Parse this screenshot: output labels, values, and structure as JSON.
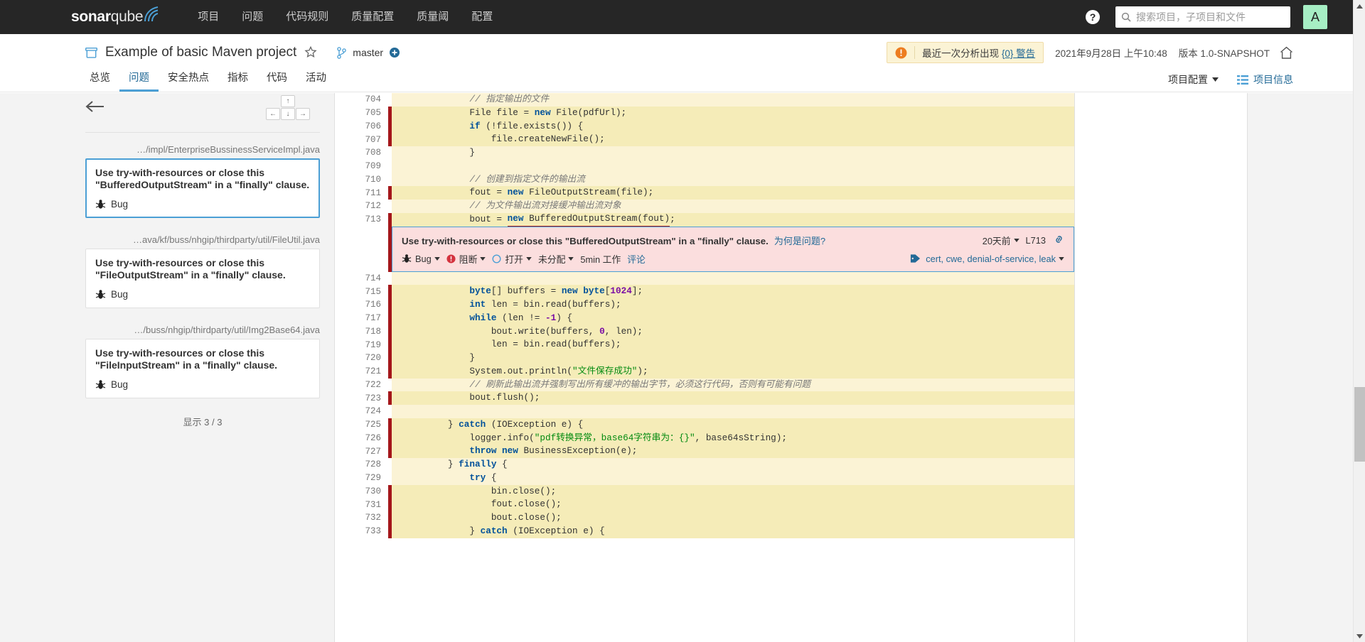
{
  "topnav": {
    "logo_bold": "sonar",
    "logo_light": "qube",
    "links": [
      {
        "label": "项目",
        "active": false
      },
      {
        "label": "问题",
        "active": false
      },
      {
        "label": "代码规则",
        "active": false
      },
      {
        "label": "质量配置",
        "active": false
      },
      {
        "label": "质量阈",
        "active": false
      },
      {
        "label": "配置",
        "active": false
      }
    ],
    "help_label": "?",
    "search_placeholder": "搜索项目，子项目和文件",
    "search_value": "",
    "avatar_letter": "A",
    "avatar_color": "#a6eec4"
  },
  "project_header": {
    "title": "Example of basic Maven project",
    "branch": "master",
    "warning_prefix": "最近一次分析出现 ",
    "warning_link": "{0} 警告",
    "analysis_date": "2021年9月28日 上午10:48",
    "version": "版本 1.0-SNAPSHOT"
  },
  "tabs": [
    {
      "label": "总览",
      "active": false
    },
    {
      "label": "问题",
      "active": true
    },
    {
      "label": "安全热点",
      "active": false
    },
    {
      "label": "指标",
      "active": false
    },
    {
      "label": "代码",
      "active": false
    },
    {
      "label": "活动",
      "active": false
    }
  ],
  "tabs_right": {
    "project_config": "项目配置",
    "project_info": "项目信息"
  },
  "sidebar": {
    "items": [
      {
        "path": "…/impl/EnterpriseBussinessServiceImpl.java",
        "message": "Use try-with-resources or close this \"BufferedOutputStream\" in a \"finally\" clause.",
        "type": "Bug",
        "selected": true
      },
      {
        "path": "…ava/kf/buss/nhgip/thirdparty/util/FileUtil.java",
        "message": "Use try-with-resources or close this \"FileOutputStream\" in a \"finally\" clause.",
        "type": "Bug",
        "selected": false
      },
      {
        "path": "…/buss/nhgip/thirdparty/util/Img2Base64.java",
        "message": "Use try-with-resources or close this \"FileInputStream\" in a \"finally\" clause.",
        "type": "Bug",
        "selected": false
      }
    ],
    "count_label": "显示 3 / 3"
  },
  "issue_detail": {
    "message": "Use try-with-resources or close this \"BufferedOutputStream\" in a \"finally\" clause.",
    "why_link": "为何是问题?",
    "date": "20天前",
    "line_label": "L713",
    "type": "Bug",
    "severity": "阻断",
    "status": "打开",
    "assignee": "未分配",
    "effort": "5min 工作",
    "comment": "评论",
    "tags": "cert, cwe, denial-of-service, leak"
  },
  "code": {
    "lines": [
      {
        "n": "704",
        "hl": "hl2",
        "bar": false,
        "clipped": true,
        "tokens": [
          {
            "t": "            // 指定输出的文件",
            "c": "cmt"
          }
        ]
      },
      {
        "n": "705",
        "hl": "hl",
        "bar": true,
        "tokens": [
          {
            "t": "            File file = ",
            "c": ""
          },
          {
            "t": "new",
            "c": "kw"
          },
          {
            "t": " File(pdfUrl);",
            "c": ""
          }
        ]
      },
      {
        "n": "706",
        "hl": "hl",
        "bar": true,
        "tokens": [
          {
            "t": "            ",
            "c": ""
          },
          {
            "t": "if",
            "c": "kw"
          },
          {
            "t": " (!file.exists()) {",
            "c": ""
          }
        ]
      },
      {
        "n": "707",
        "hl": "hl",
        "bar": true,
        "tokens": [
          {
            "t": "                file.createNewFile();",
            "c": ""
          }
        ]
      },
      {
        "n": "708",
        "hl": "hl2",
        "bar": false,
        "tokens": [
          {
            "t": "            }",
            "c": ""
          }
        ]
      },
      {
        "n": "709",
        "hl": "hl2",
        "bar": false,
        "tokens": []
      },
      {
        "n": "710",
        "hl": "hl2",
        "bar": false,
        "tokens": [
          {
            "t": "            // 创建到指定文件的输出流",
            "c": "cmt"
          }
        ]
      },
      {
        "n": "711",
        "hl": "hl",
        "bar": true,
        "tokens": [
          {
            "t": "            fout = ",
            "c": ""
          },
          {
            "t": "new",
            "c": "kw"
          },
          {
            "t": " FileOutputStream(file);",
            "c": ""
          }
        ]
      },
      {
        "n": "712",
        "hl": "hl2",
        "bar": false,
        "tokens": [
          {
            "t": "            // 为文件输出流对接缓冲输出流对象",
            "c": "cmt"
          }
        ]
      },
      {
        "n": "713",
        "hl": "hl",
        "bar": true,
        "issue_line": true,
        "tokens": [
          {
            "t": "            bout = ",
            "c": ""
          },
          {
            "t": "new",
            "c": "kw uline"
          },
          {
            "t": " BufferedOutputStream(fout)",
            "c": "uline"
          },
          {
            "t": ";",
            "c": ""
          }
        ]
      },
      {
        "n": "714",
        "hl": "hl2",
        "bar": false,
        "tokens": []
      },
      {
        "n": "715",
        "hl": "hl",
        "bar": true,
        "tokens": [
          {
            "t": "            ",
            "c": ""
          },
          {
            "t": "byte",
            "c": "kw"
          },
          {
            "t": "[] buffers = ",
            "c": ""
          },
          {
            "t": "new",
            "c": "kw"
          },
          {
            "t": " ",
            "c": ""
          },
          {
            "t": "byte",
            "c": "kw"
          },
          {
            "t": "[",
            "c": ""
          },
          {
            "t": "1024",
            "c": "num"
          },
          {
            "t": "];",
            "c": ""
          }
        ]
      },
      {
        "n": "716",
        "hl": "hl",
        "bar": true,
        "tokens": [
          {
            "t": "            ",
            "c": ""
          },
          {
            "t": "int",
            "c": "kw"
          },
          {
            "t": " len = bin.read(buffers);",
            "c": ""
          }
        ]
      },
      {
        "n": "717",
        "hl": "hl",
        "bar": true,
        "tokens": [
          {
            "t": "            ",
            "c": ""
          },
          {
            "t": "while",
            "c": "kw"
          },
          {
            "t": " (len != ",
            "c": ""
          },
          {
            "t": "-1",
            "c": "num"
          },
          {
            "t": ") {",
            "c": ""
          }
        ]
      },
      {
        "n": "718",
        "hl": "hl",
        "bar": true,
        "tokens": [
          {
            "t": "                bout.write(buffers, ",
            "c": ""
          },
          {
            "t": "0",
            "c": "num"
          },
          {
            "t": ", len);",
            "c": ""
          }
        ]
      },
      {
        "n": "719",
        "hl": "hl",
        "bar": true,
        "tokens": [
          {
            "t": "                len = bin.read(buffers);",
            "c": ""
          }
        ]
      },
      {
        "n": "720",
        "hl": "hl",
        "bar": true,
        "tokens": [
          {
            "t": "            }",
            "c": ""
          }
        ]
      },
      {
        "n": "721",
        "hl": "hl",
        "bar": true,
        "tokens": [
          {
            "t": "            System.out.println(",
            "c": ""
          },
          {
            "t": "\"文件保存成功\"",
            "c": "str"
          },
          {
            "t": ");",
            "c": ""
          }
        ]
      },
      {
        "n": "722",
        "hl": "hl2",
        "bar": false,
        "tokens": [
          {
            "t": "            // 刷新此输出流并强制写出所有缓冲的输出字节，必须这行代码，否则有可能有问题",
            "c": "cmt"
          }
        ]
      },
      {
        "n": "723",
        "hl": "hl",
        "bar": true,
        "tokens": [
          {
            "t": "            bout.flush();",
            "c": ""
          }
        ]
      },
      {
        "n": "724",
        "hl": "hl2",
        "bar": false,
        "tokens": []
      },
      {
        "n": "725",
        "hl": "hl",
        "bar": true,
        "tokens": [
          {
            "t": "        } ",
            "c": ""
          },
          {
            "t": "catch",
            "c": "kw"
          },
          {
            "t": " (IOException e) {",
            "c": ""
          }
        ]
      },
      {
        "n": "726",
        "hl": "hl",
        "bar": true,
        "tokens": [
          {
            "t": "            logger.info(",
            "c": ""
          },
          {
            "t": "\"pdf转换异常，base64字符串为：{}\"",
            "c": "str"
          },
          {
            "t": ", base64sString);",
            "c": ""
          }
        ]
      },
      {
        "n": "727",
        "hl": "hl",
        "bar": true,
        "tokens": [
          {
            "t": "            ",
            "c": ""
          },
          {
            "t": "throw new",
            "c": "kw"
          },
          {
            "t": " BusinessException(e);",
            "c": ""
          }
        ]
      },
      {
        "n": "728",
        "hl": "hl2",
        "bar": false,
        "tokens": [
          {
            "t": "        } ",
            "c": ""
          },
          {
            "t": "finally",
            "c": "kw"
          },
          {
            "t": " {",
            "c": ""
          }
        ]
      },
      {
        "n": "729",
        "hl": "hl2",
        "bar": false,
        "tokens": [
          {
            "t": "            ",
            "c": ""
          },
          {
            "t": "try",
            "c": "kw"
          },
          {
            "t": " {",
            "c": ""
          }
        ]
      },
      {
        "n": "730",
        "hl": "hl",
        "bar": true,
        "tokens": [
          {
            "t": "                bin.close();",
            "c": ""
          }
        ]
      },
      {
        "n": "731",
        "hl": "hl",
        "bar": true,
        "tokens": [
          {
            "t": "                fout.close();",
            "c": ""
          }
        ]
      },
      {
        "n": "732",
        "hl": "hl",
        "bar": true,
        "tokens": [
          {
            "t": "                bout.close();",
            "c": ""
          }
        ]
      },
      {
        "n": "733",
        "hl": "hl",
        "bar": true,
        "clipped": true,
        "tokens": [
          {
            "t": "            } ",
            "c": ""
          },
          {
            "t": "catch",
            "c": "kw"
          },
          {
            "t": " (IOException e) {",
            "c": ""
          }
        ]
      }
    ]
  },
  "icons": {
    "search": "search-icon",
    "help": "help-icon",
    "star": "star-icon",
    "branch": "branch-icon",
    "plus": "plus-circle-icon",
    "home": "home-icon",
    "warning": "warning-icon",
    "list": "list-icon",
    "bug": "bug-icon",
    "back": "back-arrow-icon",
    "link": "link-icon",
    "tag": "tag-icon",
    "severity_blocker": "blocker-severity-icon",
    "status_open": "open-status-icon"
  }
}
